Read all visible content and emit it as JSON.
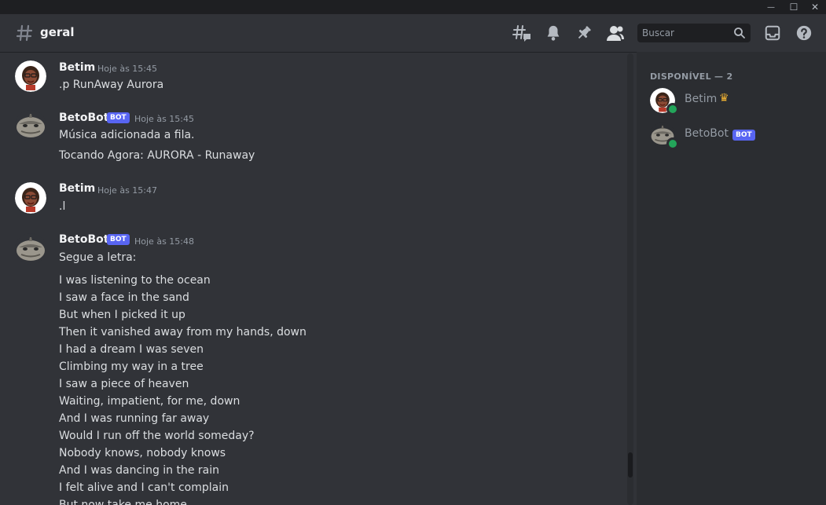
{
  "window": {
    "controls": {
      "minimize": "—",
      "maximize": "☐",
      "close": "✕"
    }
  },
  "header": {
    "channel_name": "geral",
    "icons": [
      "threads-icon",
      "bell-icon",
      "pin-icon",
      "members-icon",
      "inbox-icon",
      "help-icon"
    ],
    "search": {
      "placeholder": "Buscar"
    }
  },
  "messages": [
    {
      "author": "Betim",
      "bot": false,
      "timestamp": "Hoje às 15:45",
      "lines": [
        ".p RunAway Aurora"
      ]
    },
    {
      "author": "BetoBot",
      "bot": true,
      "badge": "BOT",
      "timestamp": "Hoje às 15:45",
      "lines": [
        "Música adicionada a fila.",
        "Tocando Agora: AURORA - Runaway"
      ]
    },
    {
      "author": "Betim",
      "bot": false,
      "timestamp": "Hoje às 15:47",
      "lines": [
        ".l"
      ]
    },
    {
      "author": "BetoBot",
      "bot": true,
      "badge": "BOT",
      "timestamp": "Hoje às 15:48",
      "lines": [
        "Segue a letra:"
      ],
      "lyrics": [
        "I was listening to the ocean",
        "I saw a face in the sand",
        "But when I picked it up",
        "Then it vanished away from my hands, down",
        "I had a dream I was seven",
        "Climbing my way in a tree",
        "I saw a piece of heaven",
        "Waiting, impatient, for me, down",
        "And I was running far away",
        "Would I run off the world someday?",
        "Nobody knows, nobody knows",
        "And I was dancing in the rain",
        "I felt alive and I can't complain",
        "But now take me home"
      ]
    }
  ],
  "members": {
    "section_title": "DISPONÍVEL — 2",
    "list": [
      {
        "name": "Betim",
        "crown": "♛",
        "status": "online"
      },
      {
        "name": "BetoBot",
        "badge": "BOT",
        "status": "online"
      }
    ]
  },
  "colors": {
    "accent": "#5865f2",
    "online": "#23a55a",
    "crown": "#f0b232",
    "background": "#313338",
    "sidebar": "#2b2d31"
  }
}
